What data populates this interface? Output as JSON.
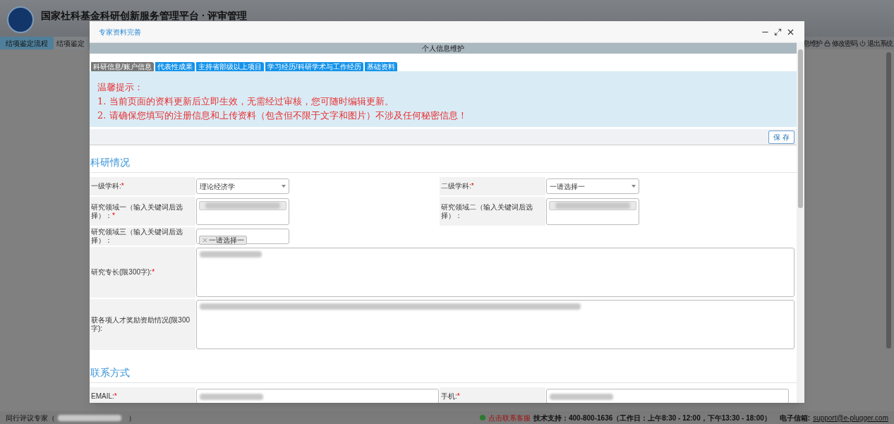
{
  "app": {
    "title": "国家社科基金科研创新服务管理平台 · 评审管理",
    "nav": [
      {
        "label": "结项鉴定流程",
        "selected": true
      },
      {
        "label": "结项鉴定",
        "selected": false
      }
    ],
    "user_links": [
      {
        "label": "息维护",
        "kind": "text"
      },
      {
        "label": "修改密码",
        "kind": "lock"
      },
      {
        "label": "退出系统",
        "kind": "power"
      }
    ]
  },
  "dialog": {
    "title": "专家资料完善",
    "header": "个人信息维护",
    "tabs": [
      {
        "label": "科研信息/账户信息",
        "selected": true
      },
      {
        "label": "代表性成果",
        "selected": false
      },
      {
        "label": "主持省部级以上项目",
        "selected": false
      },
      {
        "label": "学习经历/科研学术与工作经历",
        "selected": false
      },
      {
        "label": "基础资料",
        "selected": false
      }
    ],
    "notice": {
      "title": "温馨提示：",
      "lines": [
        "1. 当前页面的资料更新后立即生效，无需经过审核，您可随时编辑更新。",
        "2. 请确保您填写的注册信息和上传资料（包含但不限于文字和图片）不涉及任何秘密信息！"
      ]
    },
    "save_button": "保 存",
    "sections": [
      {
        "title": "科研情况",
        "rows": [
          {
            "kind": "pair",
            "fields": [
              {
                "label": "一级学科:",
                "mark": "*",
                "kind": "select",
                "value": "理论经济学"
              },
              {
                "label": "二级学科:",
                "mark": "*",
                "kind": "select",
                "value": "一请选择一"
              }
            ]
          },
          {
            "kind": "pair",
            "fields": [
              {
                "label": "研究领域一（输入关键词后选择）：",
                "mark": "*",
                "kind": "tags",
                "redacted": true
              },
              {
                "label": "研究领域二（输入关键词后选择）：",
                "kind": "tags",
                "redacted": true
              }
            ]
          },
          {
            "kind": "pair",
            "fields": [
              {
                "label": "研究领域三（输入关键词后选择）：",
                "kind": "tags",
                "redacted": false,
                "value": "一请选择一"
              }
            ]
          },
          {
            "kind": "wide",
            "fields": [
              {
                "label": "研究专长(限300字):",
                "mark": "*",
                "kind": "textarea",
                "redacted": true
              }
            ]
          },
          {
            "kind": "wide",
            "fields": [
              {
                "label": "获各项人才奖励资助情况(限300字):",
                "kind": "textarea",
                "redacted": true
              }
            ]
          }
        ]
      },
      {
        "title": "联系方式",
        "rows": [
          {
            "kind": "pair",
            "fields": [
              {
                "label": "EMAIL:",
                "mark": "*",
                "kind": "text",
                "redacted": true
              },
              {
                "label": "手机:",
                "mark": "*",
                "kind": "text",
                "redacted": true
              }
            ]
          }
        ]
      }
    ]
  },
  "status_bar": {
    "user_label": "同行评议专家（",
    "user_end": "）",
    "service_link": "点击联系客服",
    "support": "技术支持：400-800-1636（工作日：上午8:30 - 12:00，下午13:30 - 18:00）",
    "email_label": "电子信箱:",
    "email": "support@e-plugger.com"
  }
}
